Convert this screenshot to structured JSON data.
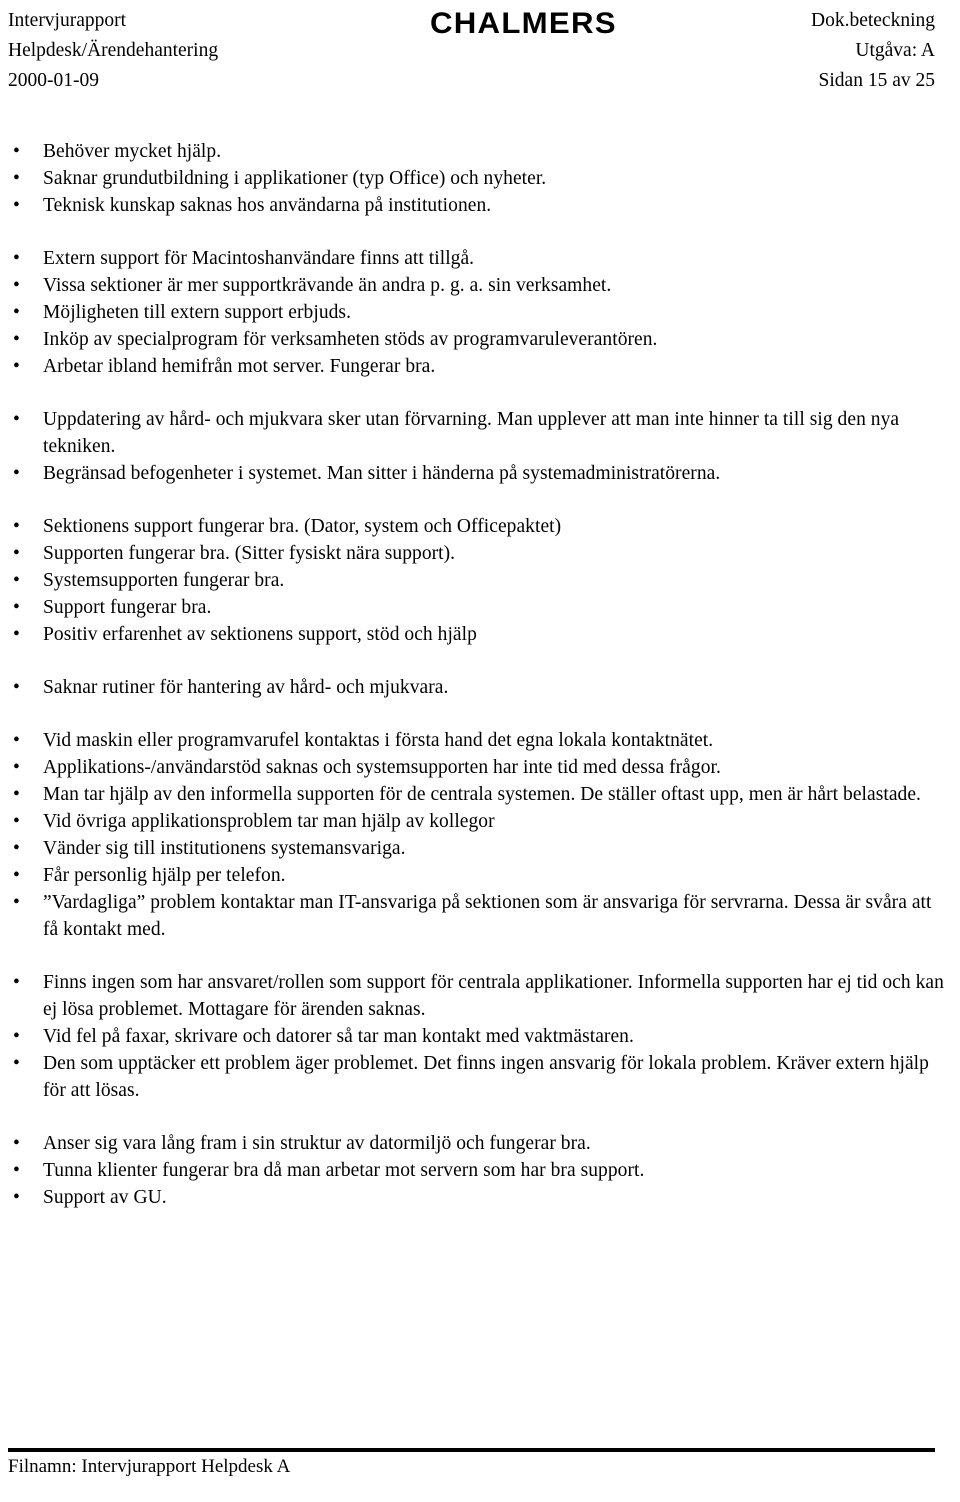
{
  "header": {
    "left_lines": [
      "Intervjurapport",
      "Helpdesk/Ärendehantering",
      "2000-01-09"
    ],
    "logo": "CHALMERS",
    "right_lines": [
      "Dok.beteckning",
      "Utgåva: A",
      "Sidan 15 av 25"
    ]
  },
  "body": {
    "bullet_char": "•",
    "groups": [
      {
        "items": [
          "Behöver mycket hjälp.",
          "Saknar grundutbildning i applikationer (typ Office) och nyheter.",
          "Teknisk kunskap saknas hos användarna på institutionen."
        ]
      },
      {
        "items": [
          "Extern support för Macintoshanvändare finns att tillgå.",
          "Vissa sektioner är mer supportkrävande än andra p. g. a. sin verksamhet.",
          "Möjligheten till extern support erbjuds.",
          "Inköp av specialprogram för verksamheten stöds av programvaruleverantören.",
          "Arbetar ibland hemifrån mot server. Fungerar bra."
        ]
      },
      {
        "items": [
          "Uppdatering av hård- och mjukvara sker utan förvarning. Man upplever att man inte hinner ta till sig den nya tekniken.",
          "Begränsad befogenheter i systemet. Man sitter i händerna på systemadministratörerna."
        ]
      },
      {
        "items": [
          "Sektionens support fungerar bra. (Dator, system och Officepaktet)",
          "Supporten fungerar bra. (Sitter fysiskt nära support).",
          "Systemsupporten fungerar bra.",
          "Support fungerar bra.",
          "Positiv erfarenhet av sektionens support, stöd och hjälp"
        ]
      },
      {
        "items": [
          "Saknar rutiner för hantering av hård- och mjukvara."
        ]
      },
      {
        "items": [
          "Vid maskin eller programvarufel kontaktas i första hand det egna lokala kontaktnätet.",
          "Applikations-/användarstöd saknas och systemsupporten har inte tid med dessa frågor.",
          "Man tar hjälp av den informella supporten för de centrala systemen. De ställer oftast upp, men är hårt belastade.",
          "Vid övriga applikationsproblem tar man hjälp av kollegor",
          "Vänder sig till institutionens systemansvariga.",
          "Får personlig hjälp per telefon.",
          "”Vardagliga” problem kontaktar man IT-ansvariga på sektionen som är ansvariga för servrarna. Dessa är svåra att få kontakt med."
        ]
      },
      {
        "items": [
          "Finns ingen som har ansvaret/rollen som support för centrala applikationer. Informella supporten har ej tid och kan ej lösa problemet. Mottagare för ärenden saknas.",
          "Vid fel på faxar, skrivare och datorer så tar man kontakt med vaktmästaren.",
          "Den som upptäcker ett problem äger problemet. Det finns ingen ansvarig för lokala problem. Kräver extern hjälp för att lösas."
        ]
      },
      {
        "items": [
          "Anser sig vara lång fram i sin struktur av datormiljö och fungerar bra.",
          "Tunna klienter fungerar bra då man arbetar mot servern som har bra support.",
          "Support av GU."
        ]
      }
    ]
  },
  "footer": {
    "text": "Filnamn: Intervjurapport Helpdesk A"
  }
}
